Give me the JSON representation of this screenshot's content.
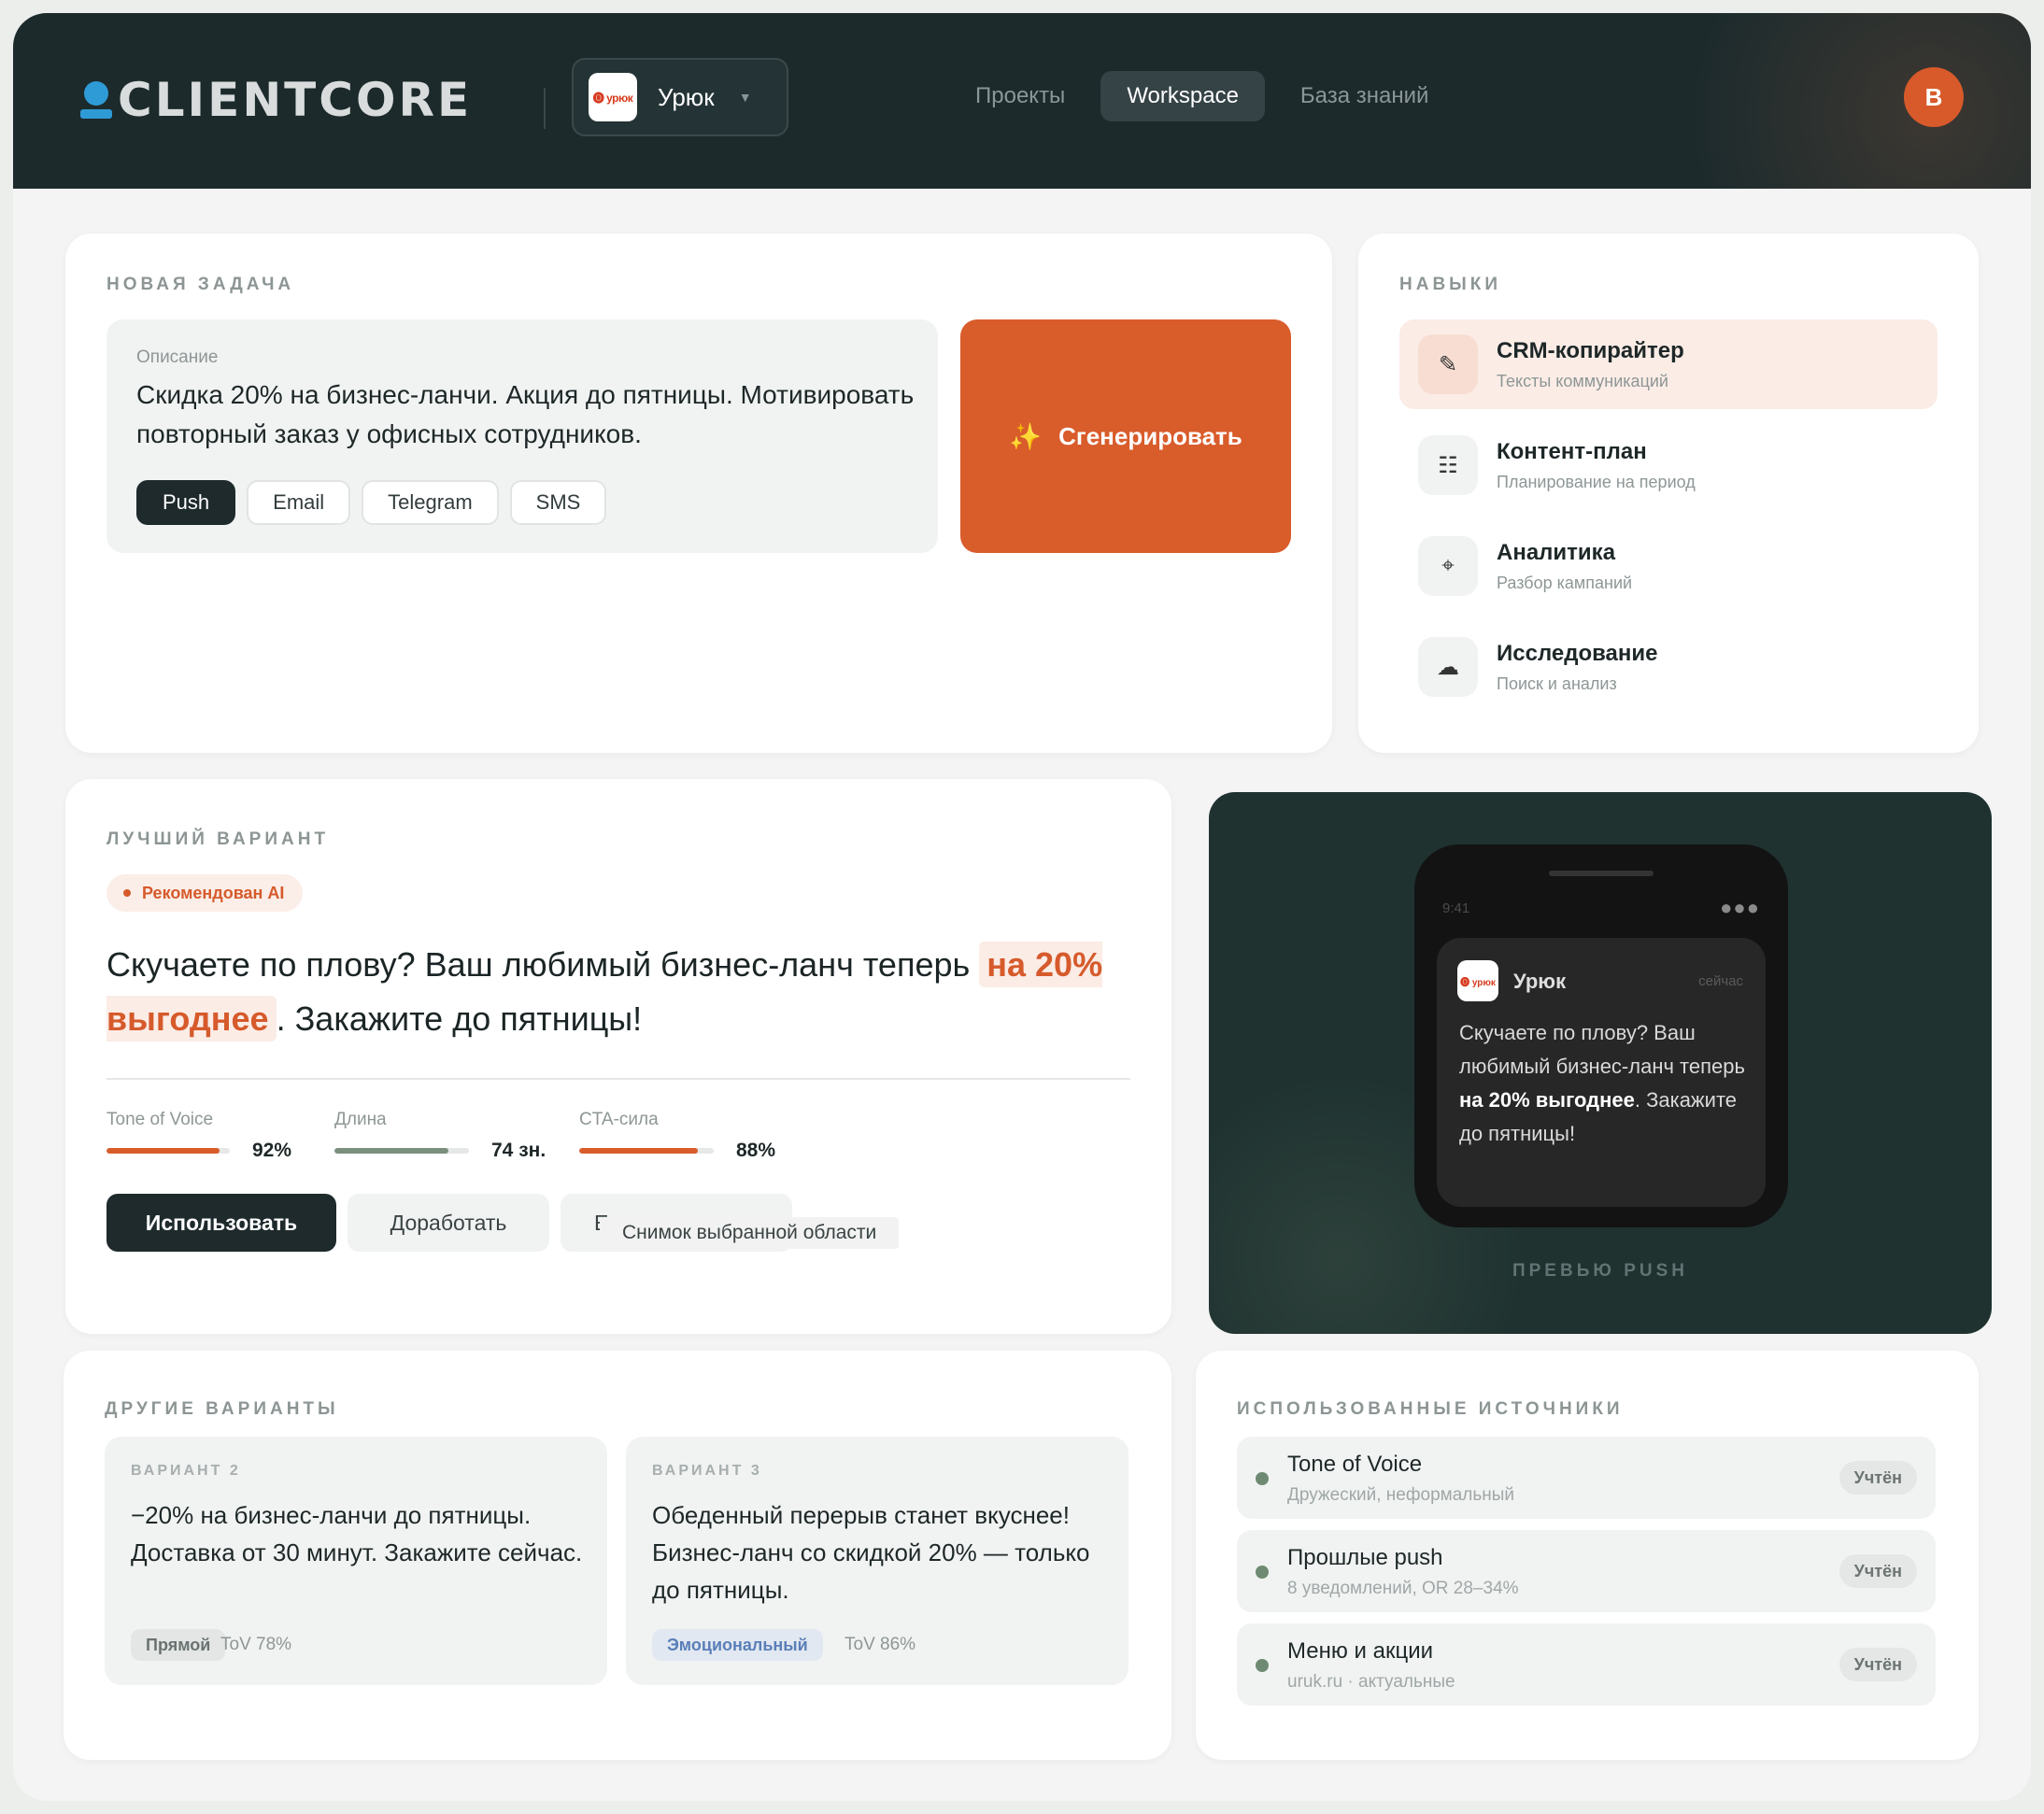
{
  "header": {
    "logo_text": "CLIENTCORE",
    "workspace": {
      "logo_text": "🅞 урюк",
      "name": "Урюк"
    },
    "nav": [
      "Проекты",
      "Workspace",
      "База знаний"
    ],
    "avatar": "B"
  },
  "task": {
    "section_title": "НОВАЯ ЗАДАЧА",
    "desc_label": "Описание",
    "desc_text": "Скидка 20% на бизнес-ланчи. Акция до пятницы. Мотивировать повторный заказ у офисных сотрудников.",
    "channels": [
      "Push",
      "Email",
      "Telegram",
      "SMS"
    ],
    "active_channel": "Push",
    "generate_label": "Сгенерировать"
  },
  "skills": {
    "section_title": "НАВЫКИ",
    "items": [
      {
        "title": "CRM-копирайтер",
        "subtitle": "Тексты коммуникаций",
        "icon": "pencil-icon",
        "glyph": "✎"
      },
      {
        "title": "Контент-план",
        "subtitle": "Планирование на период",
        "icon": "list-icon",
        "glyph": "☷"
      },
      {
        "title": "Аналитика",
        "subtitle": "Разбор кампаний",
        "icon": "crosshair-icon",
        "glyph": "⌖"
      },
      {
        "title": "Исследование",
        "subtitle": "Поиск и анализ",
        "icon": "cloud-icon",
        "glyph": "☁"
      }
    ]
  },
  "best": {
    "section_title": "ЛУЧШИЙ ВАРИАНТ",
    "badge": "Рекомендован AI",
    "text_before": "Скучаете по плову? Ваш любимый бизнес-ланч теперь",
    "text_highlight": "на 20% выгоднее",
    "text_after": ". Закажите до пятницы!",
    "metrics": [
      {
        "label": "Tone of Voice",
        "value": "92%",
        "fill": 0.92,
        "color": "#d95c2b"
      },
      {
        "label": "Длина",
        "value": "74 зн.",
        "fill": 0.85,
        "color": "#7a8f7c"
      },
      {
        "label": "CTA-сила",
        "value": "88%",
        "fill": 0.88,
        "color": "#d95c2b"
      }
    ],
    "buttons": {
      "use": "Использовать",
      "refine": "Доработать",
      "third": "Е"
    },
    "tooltip": "Снимок выбранной области"
  },
  "preview": {
    "time": "9:41",
    "app": "Урюк",
    "app_logo": "🅞 урюк",
    "notif_time": "сейчас",
    "text_before": "Скучаете по плову? Ваш любимый бизнес-ланч теперь",
    "text_bold": "на 20% выгоднее",
    "text_after": ". Закажите до пятницы!",
    "label": "ПРЕВЬЮ PUSH"
  },
  "others": {
    "section_title": "ДРУГИЕ ВАРИАНТЫ",
    "items": [
      {
        "label": "ВАРИАНТ 2",
        "text": "−20% на бизнес-ланчи до пятницы. Доставка от 30 минут. Закажите сейчас.",
        "tag": "Прямой",
        "tag_bg": "#e3e6e4",
        "tag_color": "#6a7272",
        "tov": "ToV 78%"
      },
      {
        "label": "ВАРИАНТ 3",
        "text": "Обеденный перерыв станет вкуснее! Бизнес-ланч со скидкой 20% — только до пятницы.",
        "tag": "Эмоциональный",
        "tag_bg": "#e2e8f1",
        "tag_color": "#5a7fb8",
        "tov": "ToV 86%"
      }
    ]
  },
  "sources": {
    "section_title": "ИСПОЛЬЗОВАННЫЕ ИСТОЧНИКИ",
    "items": [
      {
        "title": "Tone of Voice",
        "subtitle": "Дружеский, неформальный",
        "status": "Учтён"
      },
      {
        "title": "Прошлые push",
        "subtitle": "8 уведомлений, OR 28–34%",
        "status": "Учтён"
      },
      {
        "title": "Меню и акции",
        "subtitle": "uruk.ru · актуальные",
        "status": "Учтён"
      }
    ]
  },
  "colors": {
    "accent": "#d95c2b",
    "dark": "#1c2a2c",
    "positive": "#6f8a72"
  }
}
